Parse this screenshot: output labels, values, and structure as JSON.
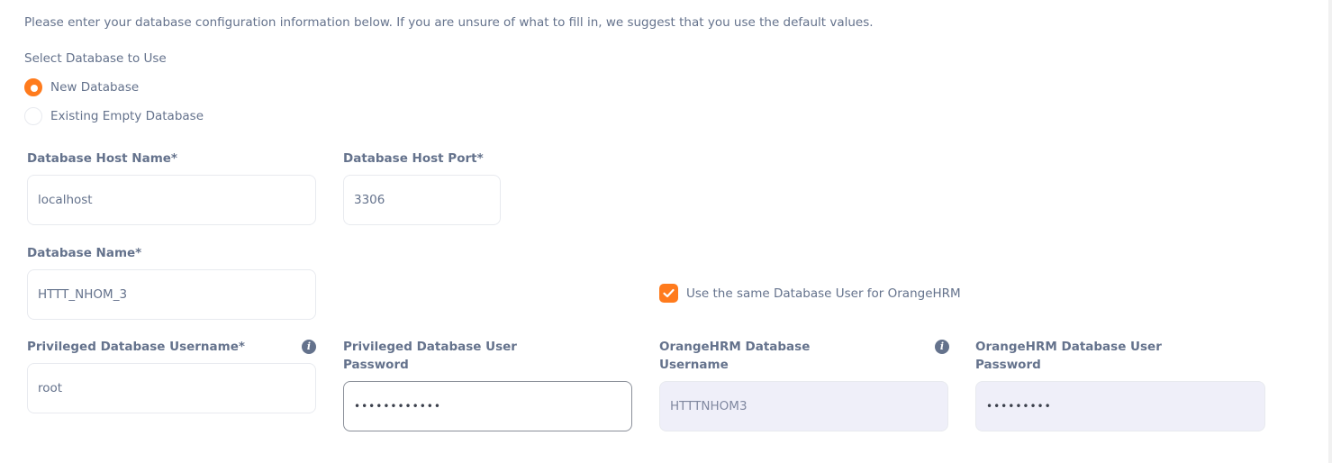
{
  "intro_text": "Please enter your database configuration information below. If you are unsure of what to fill in, we suggest that you use the default values.",
  "select_db_label": "Select Database to Use",
  "radios": [
    {
      "label": "New Database",
      "checked": true
    },
    {
      "label": "Existing Empty Database",
      "checked": false
    }
  ],
  "fields": {
    "host_name": {
      "label": "Database Host Name*",
      "value": "localhost"
    },
    "host_port": {
      "label": "Database Host Port*",
      "value": "3306"
    },
    "db_name": {
      "label": "Database Name*",
      "value": "HTTT_NHOM_3"
    },
    "priv_username": {
      "label": "Privileged Database Username*",
      "value": "root"
    },
    "priv_password": {
      "label_line1": "Privileged Database User",
      "label_line2": "Password",
      "value": "••••••••••••"
    },
    "ohrm_username": {
      "label_line1": "OrangeHRM Database",
      "label_line2": "Username",
      "value": "HTTTNHOM3"
    },
    "ohrm_password": {
      "label_line1": "OrangeHRM Database User",
      "label_line2": "Password",
      "value": "•••••••••"
    }
  },
  "same_user_checkbox": {
    "label": "Use the same Database User for OrangeHRM",
    "checked": true
  },
  "icons": {
    "info": "info-icon",
    "check": "check-icon"
  },
  "colors": {
    "accent": "#ff7b1d",
    "text": "#64728c",
    "disabled_bg": "#efeff9",
    "border": "#e8eaef"
  }
}
